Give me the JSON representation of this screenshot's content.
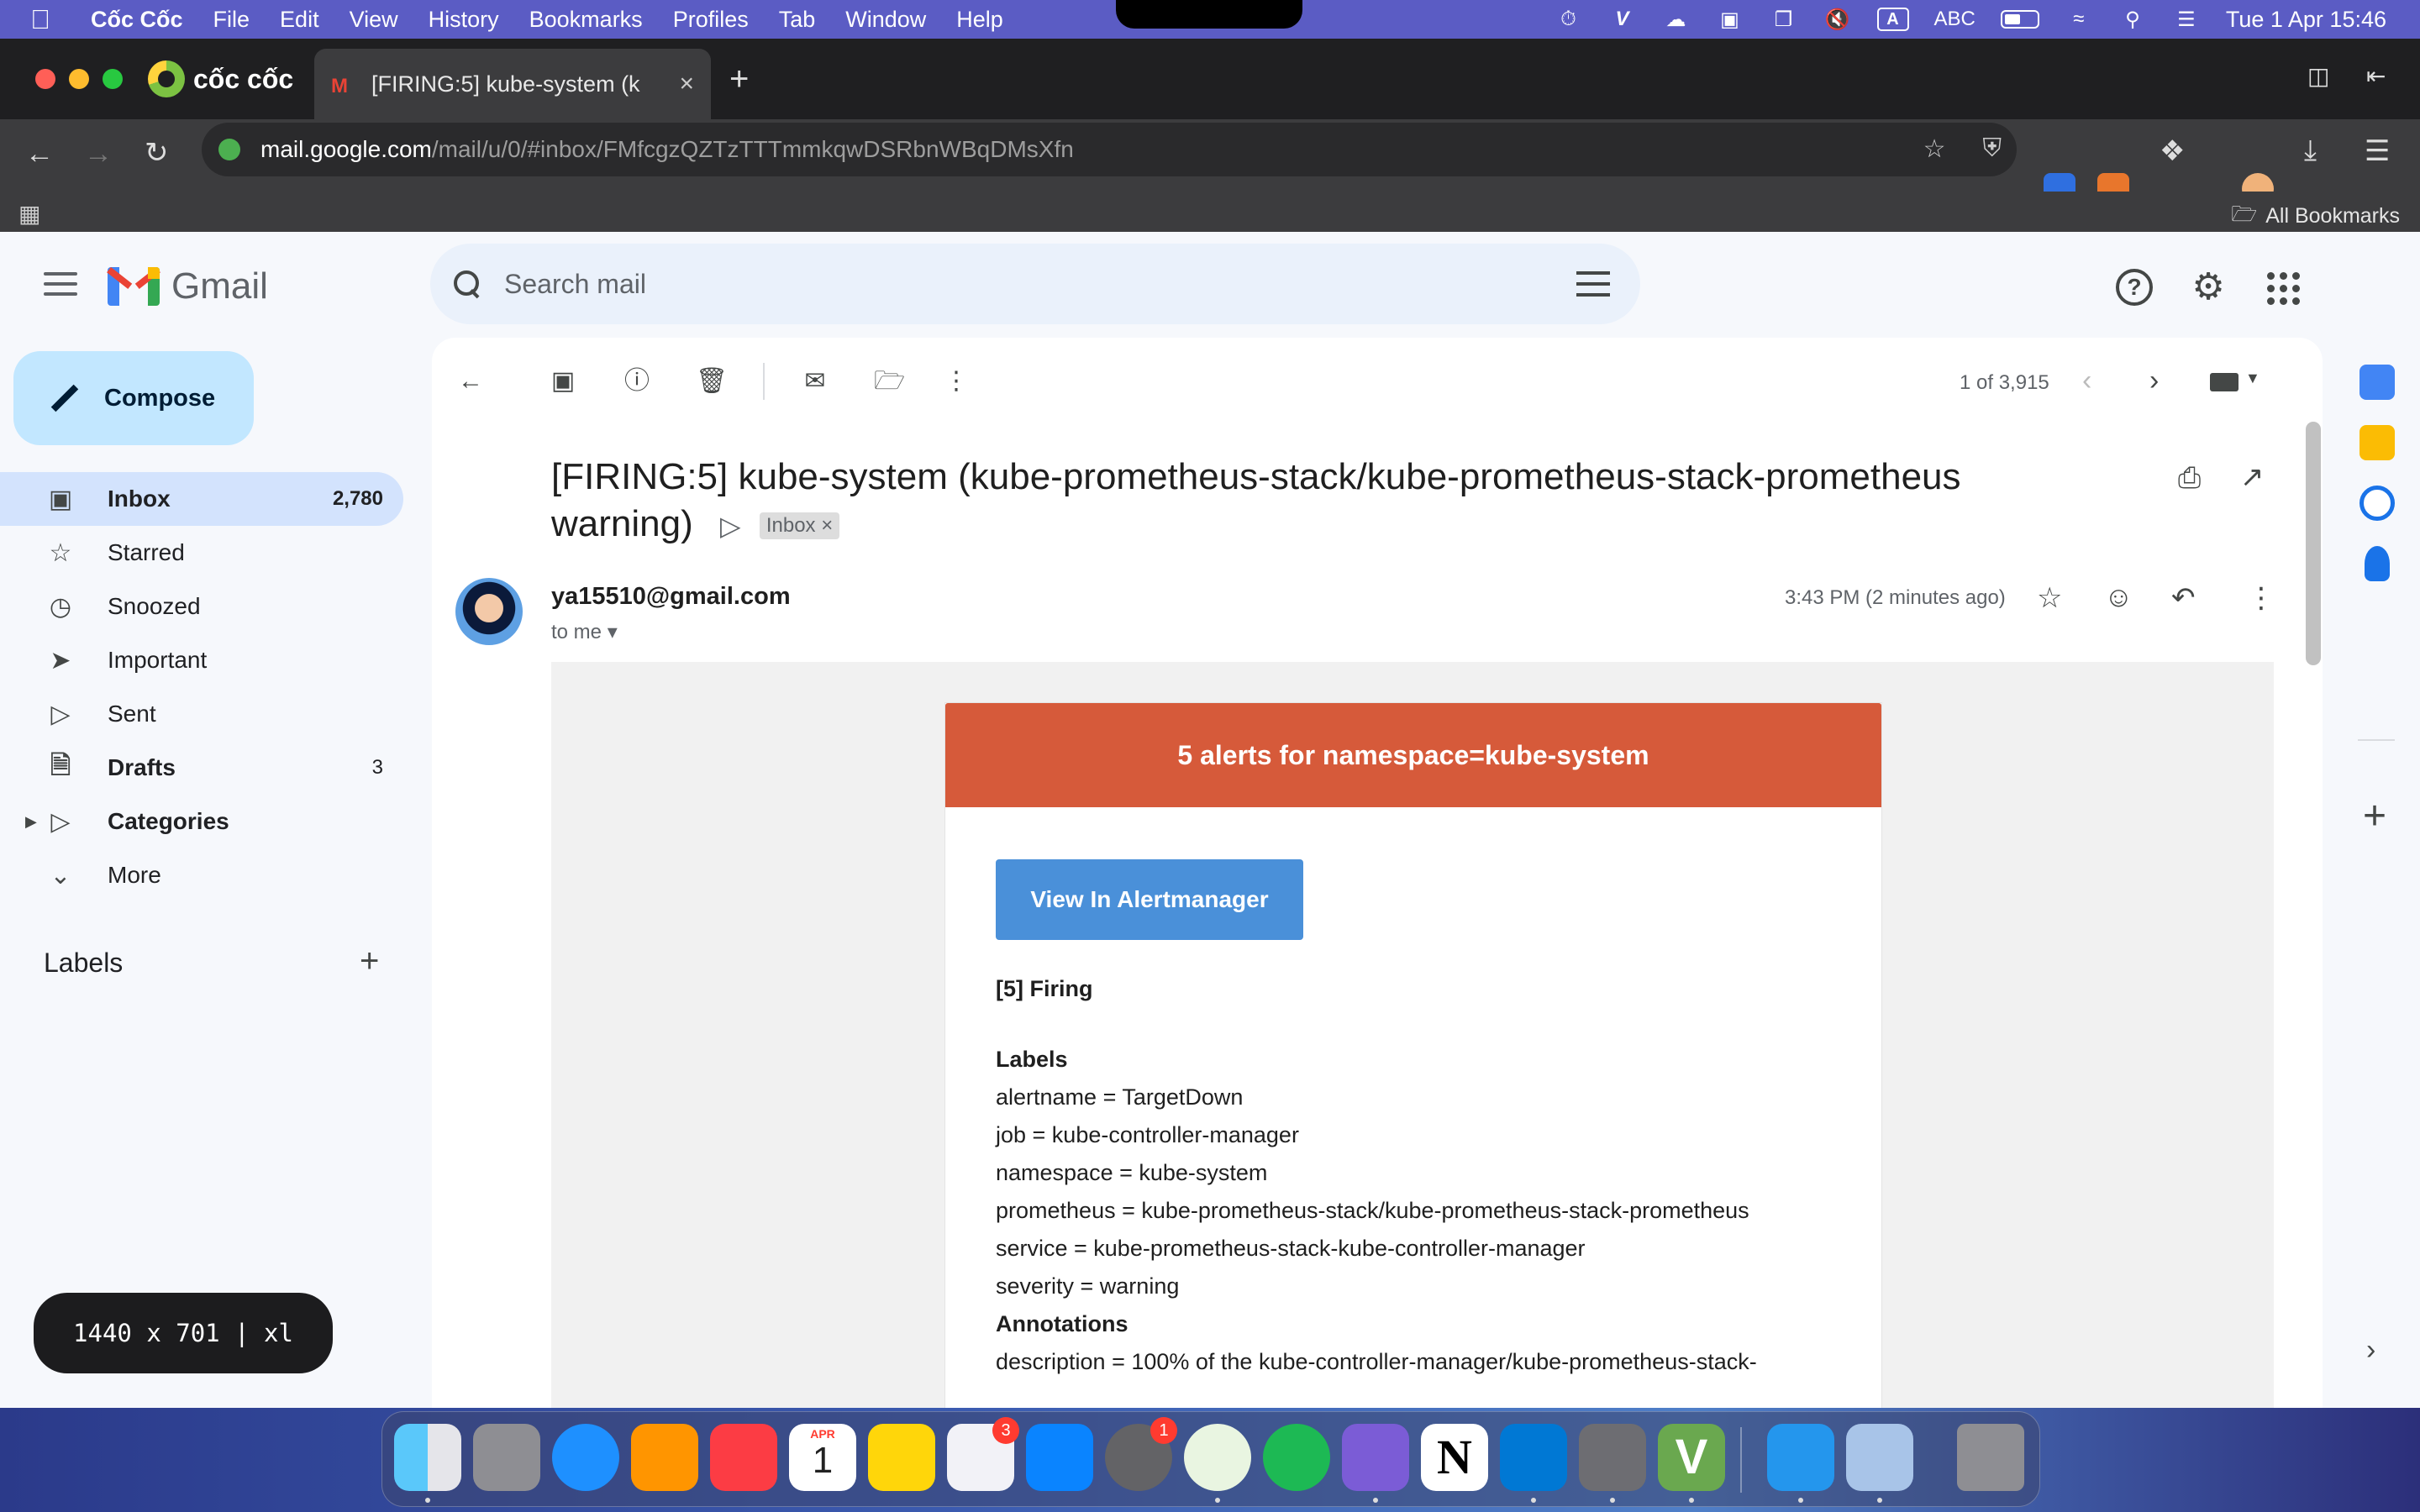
{
  "menubar": {
    "app_name": "Cốc Cốc",
    "items": [
      "File",
      "Edit",
      "View",
      "History",
      "Bookmarks",
      "Profiles",
      "Tab",
      "Window",
      "Help"
    ],
    "input_source": "ABC",
    "input_badge": "A",
    "datetime": "Tue 1 Apr  15:46"
  },
  "browser": {
    "brand_tab": "cốc cốc",
    "active_tab_title": "[FIRING:5] kube-system (k",
    "url_domain": "mail.google.com",
    "url_path": "/mail/u/0/#inbox/FMfcgzQZTzTTTmmkqwDSRbnWBqDMsXfn",
    "bookmarks_label": "All Bookmarks"
  },
  "gmail": {
    "logo_text": "Gmail",
    "search_placeholder": "Search mail",
    "compose_label": "Compose",
    "nav": [
      {
        "label": "Inbox",
        "count": "2,780",
        "icon": "inbox-icon"
      },
      {
        "label": "Starred",
        "count": "",
        "icon": "star-icon"
      },
      {
        "label": "Snoozed",
        "count": "",
        "icon": "clock-icon"
      },
      {
        "label": "Important",
        "count": "",
        "icon": "important-icon"
      },
      {
        "label": "Sent",
        "count": "",
        "icon": "send-icon"
      },
      {
        "label": "Drafts",
        "count": "3",
        "icon": "draft-icon"
      },
      {
        "label": "Categories",
        "count": "",
        "icon": "label-icon"
      },
      {
        "label": "More",
        "count": "",
        "icon": "chevron-down-icon"
      }
    ],
    "labels_heading": "Labels",
    "viewport_badge": "1440 x 701 | xl"
  },
  "message": {
    "position": "1 of 3,915",
    "subject": "[FIRING:5] kube-system (kube-prometheus-stack/kube-prometheus-stack-prometheus warning)",
    "inbox_chip": "Inbox",
    "sender": "ya15510@gmail.com",
    "to": "to me",
    "time": "3:43 PM (2 minutes ago)"
  },
  "alert": {
    "header": "5 alerts for namespace=kube-system",
    "button": "View In Alertmanager",
    "firing": "[5] Firing",
    "labels_heading": "Labels",
    "labels": [
      "alertname = TargetDown",
      "job = kube-controller-manager",
      "namespace = kube-system",
      "prometheus = kube-prometheus-stack/kube-prometheus-stack-prometheus",
      "service = kube-prometheus-stack-kube-controller-manager",
      "severity = warning"
    ],
    "annotations_heading": "Annotations",
    "annotations": [
      "description = 100% of the kube-controller-manager/kube-prometheus-stack-"
    ]
  },
  "dock": {
    "calendar_month": "APR",
    "calendar_day": "1",
    "reminders_badge": "3",
    "settings_badge": "1"
  },
  "colors": {
    "alert_header": "#d65a3a",
    "alert_button": "#4a90d9",
    "compose_bg": "#c2e7ff",
    "active_nav": "#d3e3fd"
  }
}
